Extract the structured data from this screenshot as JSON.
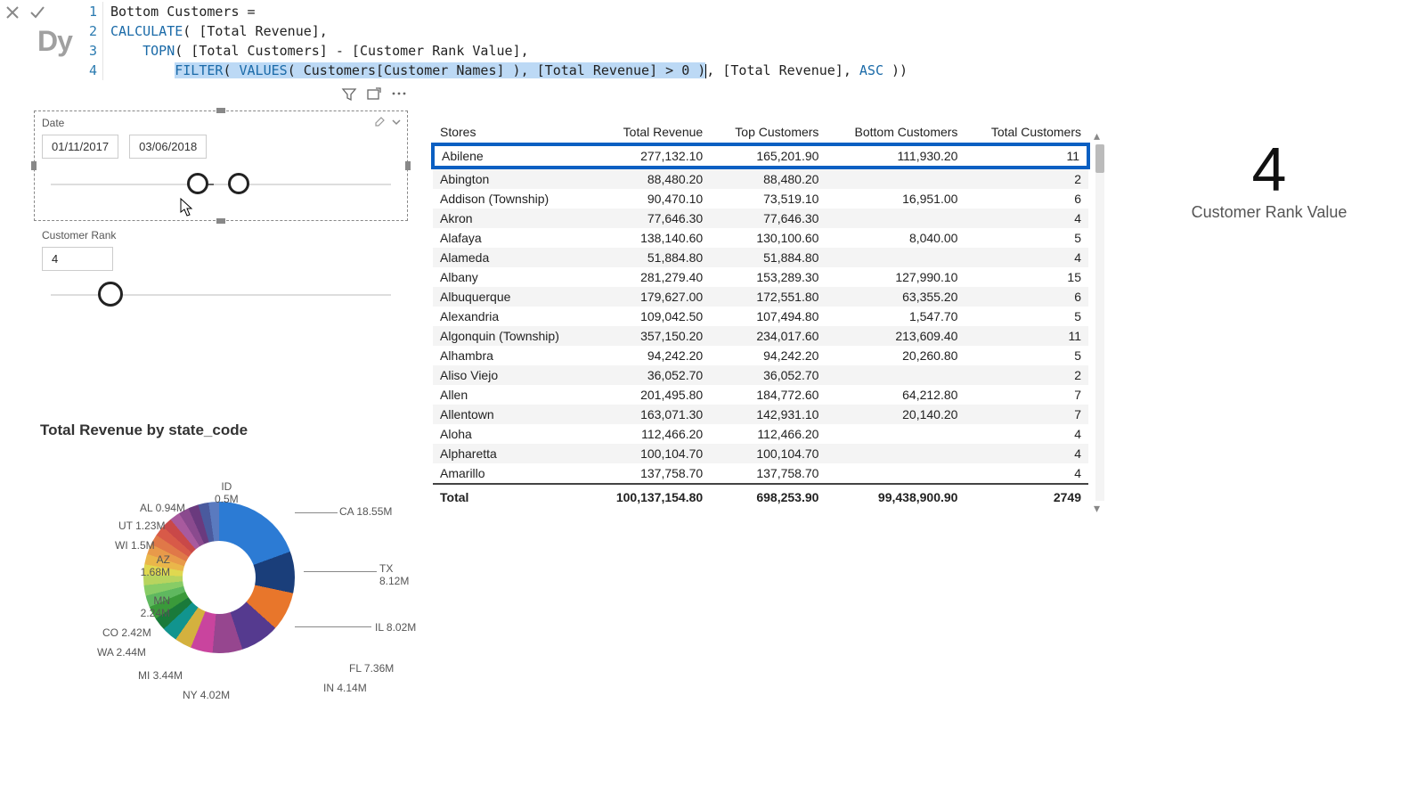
{
  "formula": {
    "lines": {
      "1": "Bottom Customers =",
      "2a": "CALCULATE",
      "2b": "( [Total Revenue],",
      "3a": "TOPN",
      "3b": "( [Total Customers] - [Customer Rank Value],",
      "4a": "FILTER",
      "4b": "( ",
      "4c": "VALUES",
      "4d": "( Customers[Customer Names] ), [Total Revenue] > 0 )",
      "4e": ", [Total Revenue], ",
      "4f": "ASC",
      "4g": " ))"
    }
  },
  "slicers": {
    "date": {
      "title": "Date",
      "from": "01/11/2017",
      "to": "03/06/2018"
    },
    "rank": {
      "title": "Customer Rank",
      "value": "4"
    }
  },
  "card": {
    "value": "4",
    "label": "Customer Rank Value"
  },
  "table": {
    "headers": {
      "stores": "Stores",
      "rev": "Total Revenue",
      "top": "Top Customers",
      "bottom": "Bottom Customers",
      "total": "Total Customers"
    },
    "rows": [
      {
        "stores": "Abilene",
        "rev": "277,132.10",
        "top": "165,201.90",
        "bottom": "111,930.20",
        "total": "11",
        "hl": true
      },
      {
        "stores": "Abington",
        "rev": "88,480.20",
        "top": "88,480.20",
        "bottom": "",
        "total": "2"
      },
      {
        "stores": "Addison (Township)",
        "rev": "90,470.10",
        "top": "73,519.10",
        "bottom": "16,951.00",
        "total": "6"
      },
      {
        "stores": "Akron",
        "rev": "77,646.30",
        "top": "77,646.30",
        "bottom": "",
        "total": "4"
      },
      {
        "stores": "Alafaya",
        "rev": "138,140.60",
        "top": "130,100.60",
        "bottom": "8,040.00",
        "total": "5"
      },
      {
        "stores": "Alameda",
        "rev": "51,884.80",
        "top": "51,884.80",
        "bottom": "",
        "total": "4"
      },
      {
        "stores": "Albany",
        "rev": "281,279.40",
        "top": "153,289.30",
        "bottom": "127,990.10",
        "total": "15"
      },
      {
        "stores": "Albuquerque",
        "rev": "179,627.00",
        "top": "172,551.80",
        "bottom": "63,355.20",
        "total": "6"
      },
      {
        "stores": "Alexandria",
        "rev": "109,042.50",
        "top": "107,494.80",
        "bottom": "1,547.70",
        "total": "5"
      },
      {
        "stores": "Algonquin (Township)",
        "rev": "357,150.20",
        "top": "234,017.60",
        "bottom": "213,609.40",
        "total": "11"
      },
      {
        "stores": "Alhambra",
        "rev": "94,242.20",
        "top": "94,242.20",
        "bottom": "20,260.80",
        "total": "5"
      },
      {
        "stores": "Aliso Viejo",
        "rev": "36,052.70",
        "top": "36,052.70",
        "bottom": "",
        "total": "2"
      },
      {
        "stores": "Allen",
        "rev": "201,495.80",
        "top": "184,772.60",
        "bottom": "64,212.80",
        "total": "7"
      },
      {
        "stores": "Allentown",
        "rev": "163,071.30",
        "top": "142,931.10",
        "bottom": "20,140.20",
        "total": "7"
      },
      {
        "stores": "Aloha",
        "rev": "112,466.20",
        "top": "112,466.20",
        "bottom": "",
        "total": "4"
      },
      {
        "stores": "Alpharetta",
        "rev": "100,104.70",
        "top": "100,104.70",
        "bottom": "",
        "total": "4"
      },
      {
        "stores": "Amarillo",
        "rev": "137,758.70",
        "top": "137,758.70",
        "bottom": "",
        "total": "4"
      }
    ],
    "footer": {
      "stores": "Total",
      "rev": "100,137,154.80",
      "top": "698,253.90",
      "bottom": "99,438,900.90",
      "total": "2749"
    }
  },
  "chart_data": {
    "type": "pie",
    "title": "Total Revenue by state_code",
    "series": [
      {
        "name": "CA",
        "label": "CA 18.55M",
        "value": 18.55
      },
      {
        "name": "TX",
        "label": "TX 8.12M",
        "value": 8.12
      },
      {
        "name": "IL",
        "label": "IL 8.02M",
        "value": 8.02
      },
      {
        "name": "FL",
        "label": "FL 7.36M",
        "value": 7.36
      },
      {
        "name": "IN",
        "label": "IN 4.14M",
        "value": 4.14
      },
      {
        "name": "NY",
        "label": "NY 4.02M",
        "value": 4.02
      },
      {
        "name": "MI",
        "label": "MI 3.44M",
        "value": 3.44
      },
      {
        "name": "WA",
        "label": "WA 2.44M",
        "value": 2.44
      },
      {
        "name": "CO",
        "label": "CO 2.42M",
        "value": 2.42
      },
      {
        "name": "MN",
        "label": "MN 2.24M",
        "value": 2.24
      },
      {
        "name": "AZ",
        "label": "AZ 1.68M",
        "value": 1.68
      },
      {
        "name": "WI",
        "label": "WI 1.5M",
        "value": 1.5
      },
      {
        "name": "UT",
        "label": "UT 1.23M",
        "value": 1.23
      },
      {
        "name": "AL",
        "label": "AL 0.94M",
        "value": 0.94
      },
      {
        "name": "ID",
        "label": "ID 0.5M",
        "value": 0.5
      }
    ]
  }
}
